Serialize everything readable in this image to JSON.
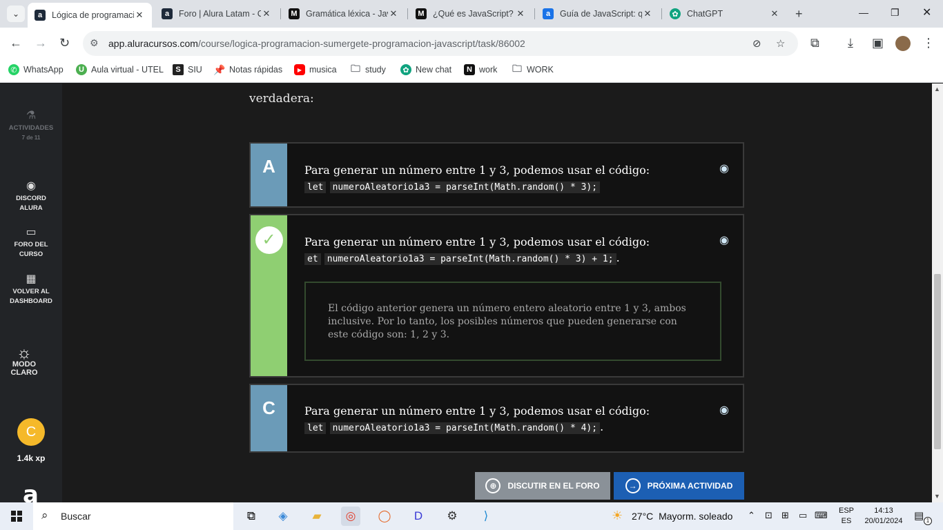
{
  "browser": {
    "tabs": [
      {
        "title": "Lógica de programación",
        "favicon": "alura-icon",
        "active": true
      },
      {
        "title": "Foro | Alura Latam - Cursos",
        "favicon": "alura-icon",
        "active": false
      },
      {
        "title": "Gramática léxica - JavaScript",
        "favicon": "mdn-icon",
        "active": false
      },
      {
        "title": "¿Qué es JavaScript? - MDN",
        "favicon": "mdn-icon",
        "active": false
      },
      {
        "title": "Guía de JavaScript: qué es",
        "favicon": "alura-icon",
        "active": false
      },
      {
        "title": "ChatGPT",
        "favicon": "chatgpt-icon",
        "active": false
      }
    ],
    "url_host": "app.aluracursos.com",
    "url_path": "/course/logica-programacion-sumergete-programacion-javascript/task/86002",
    "bookmarks": [
      {
        "label": "WhatsApp",
        "icon": "whatsapp-icon",
        "color": "#25d366"
      },
      {
        "label": "Aula virtual - UTEL",
        "icon": "utel-icon",
        "color": "#4caf50"
      },
      {
        "label": "SIU",
        "icon": "siu-icon",
        "color": "#222222"
      },
      {
        "label": "Notas rápidas",
        "icon": "pin-icon",
        "color": "#e53935"
      },
      {
        "label": "musica",
        "icon": "youtube-icon",
        "color": "#ff0000"
      },
      {
        "label": "study",
        "icon": "folder-icon",
        "color": "#5f6368"
      },
      {
        "label": "New chat",
        "icon": "chatgpt-icon",
        "color": "#10a37f"
      },
      {
        "label": "work",
        "icon": "notion-icon",
        "color": "#111111"
      },
      {
        "label": "WORK",
        "icon": "folder-icon",
        "color": "#5f6368"
      }
    ]
  },
  "sidebar": {
    "activities_label": "ACTIVIDADES",
    "activities_count": "7 de 11",
    "discord_label": "DISCORD ALURA",
    "forum_label": "FORO DEL CURSO",
    "dashboard_label": "VOLVER AL DASHBOARD",
    "mode_label": "MODO CLARO",
    "avatar_letter": "C",
    "xp": "1.4k xp"
  },
  "question": {
    "intro_visible": "verdadera:",
    "options": [
      {
        "letter": "A",
        "text": "Para generar un número entre 1 y 3, podemos usar el código:",
        "code1": "let",
        "code2": "numeroAleatorio1a3 = parseInt(Math.random() * 3);",
        "suffix": ""
      },
      {
        "letter": "✓",
        "text": "Para generar un número entre 1 y 3, podemos usar el código:",
        "code1": "et",
        "code2": "numeroAleatorio1a3 = parseInt(Math.random() * 3) + 1;",
        "suffix": ".",
        "explanation": "El código anterior genera un número entero aleatorio entre 1 y 3, ambos inclusive. Por lo tanto, los posibles números que pueden generarse con este código son: 1, 2 y 3."
      },
      {
        "letter": "C",
        "text": "Para generar un número entre 1 y 3, podemos usar el código:",
        "code1": "let",
        "code2": "numeroAleatorio1a3 = parseInt(Math.random() * 4);",
        "suffix": "."
      }
    ]
  },
  "buttons": {
    "forum": "DISCUTIR EN EL FORO",
    "next": "PRÓXIMA ACTIVIDAD"
  },
  "colors": {
    "badge_blue": "#6b9bb8",
    "badge_green": "#8fcf72",
    "btn_forum": "#8a9198",
    "btn_next": "#1c5fb3"
  },
  "taskbar": {
    "search": "Buscar",
    "temperature": "27°C",
    "weather": "Mayorm. soleado",
    "lang_top": "ESP",
    "lang_bottom": "ES",
    "time": "14:13",
    "date": "20/01/2024",
    "notif_count": "1"
  }
}
